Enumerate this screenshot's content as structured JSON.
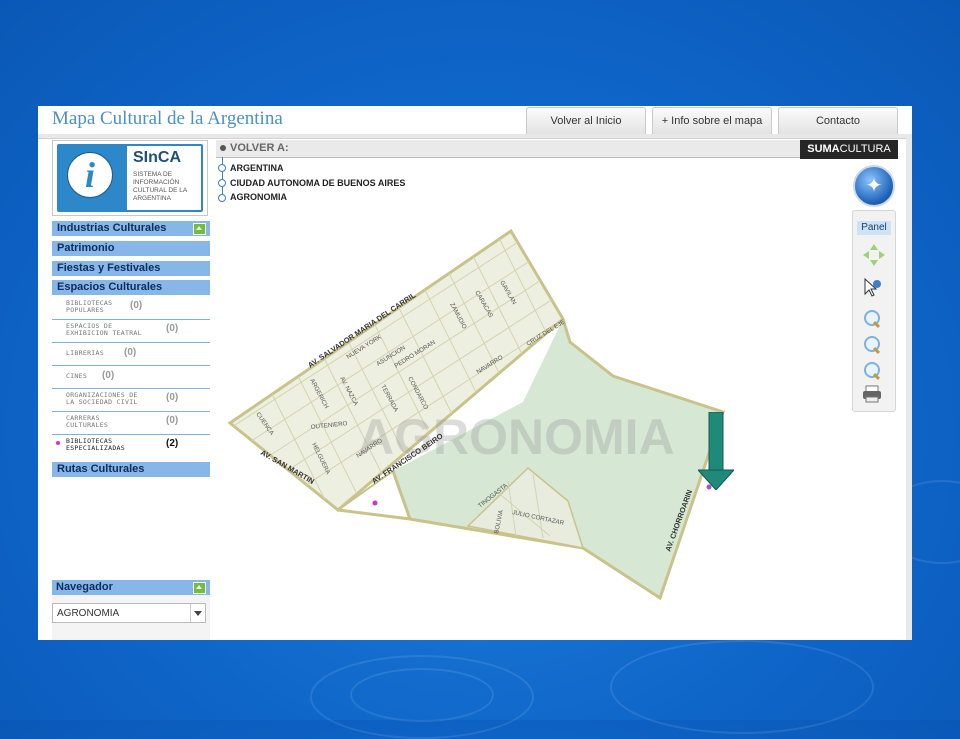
{
  "app": {
    "title": "Mapa Cultural de la Argentina",
    "top_buttons": [
      "Volver al Inicio",
      "+ Info sobre el mapa",
      "Contacto"
    ]
  },
  "logo": {
    "glyph": "i",
    "name": "SInCA",
    "subtitle": "SISTEMA DE INFORMACIÓN CULTURAL DE LA ARGENTINA"
  },
  "sidebar": {
    "categories": [
      "Industrias Culturales",
      "Patrimonio",
      "Fiestas y Festivales",
      "Espacios Culturales"
    ],
    "sub_items": [
      {
        "label": "BIBLIOTECAS\nPOPULARES",
        "count": "(0)"
      },
      {
        "label": "ESPACIOS DE\nEXHIBICION TEATRAL",
        "count": "(0)"
      },
      {
        "label": "LIBRERIAS",
        "count": "(0)"
      },
      {
        "label": "CINES",
        "count": "(0)"
      },
      {
        "label": "ORGANIZACIONES DE\nLA SOCIEDAD CIVIL",
        "count": "(0)"
      },
      {
        "label": "CARRERAS\nCULTURALES",
        "count": "(0)"
      },
      {
        "label": "BIBLIOTECAS\nESPECIALIZADAS",
        "count": "(2)"
      }
    ],
    "last_category": "Rutas Culturales",
    "navigator": {
      "title": "Navegador",
      "selected": "AGRONOMIA"
    }
  },
  "breadcrumb": {
    "title": "VOLVER A:",
    "items": [
      "ARGENTINA",
      "CIUDAD AUTONOMA DE BUENOS AIRES",
      "AGRONOMIA"
    ]
  },
  "brand": {
    "bold": "SUMA",
    "rest": "CULTURA"
  },
  "tools": {
    "panel_label": "Panel",
    "compass_glyph": "✦"
  },
  "map": {
    "watermark": "AGRONOMIA",
    "avenues": [
      "AV. SALVADOR MARIA DEL CARRIL",
      "AV. FRANCISCO BEIRO",
      "AV. SAN MARTIN",
      "AV. CHORROARIN",
      "AV. NAZCA"
    ],
    "streets": [
      "GAVILAN",
      "CARACAS",
      "ZAMUDIO",
      "PEDRO MORAN",
      "NUEVA YORK",
      "ASUNCION",
      "NAVARRO",
      "CRUZ DEL EJE",
      "CONDARCO",
      "TERRADA",
      "ARGERICH",
      "OUTENIERO",
      "NAVARRO",
      "CUENCA",
      "HELGUERA",
      "TINOGASTA",
      "JULIO CORTAZAR",
      "BOLIVIA"
    ]
  },
  "colors": {
    "accent": "#87b7e8",
    "park": "#d6e8d4",
    "border": "#c9c38a",
    "arrow": "#1f8a7a"
  }
}
